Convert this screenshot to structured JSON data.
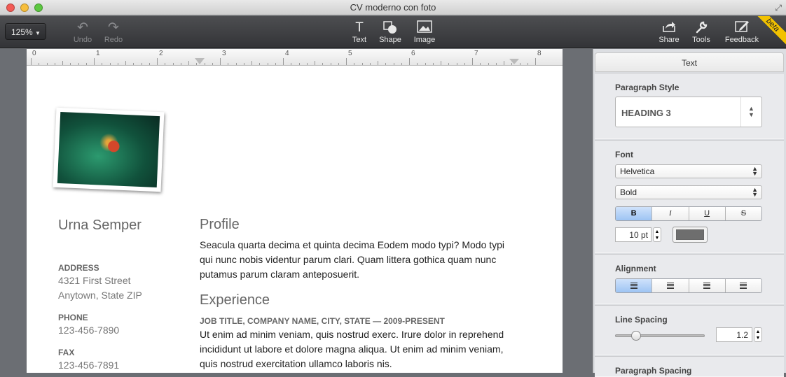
{
  "window": {
    "title": "CV moderno con foto"
  },
  "toolbar": {
    "zoom": "125%",
    "undo": "Undo",
    "redo": "Redo",
    "text": "Text",
    "shape": "Shape",
    "image": "Image",
    "share": "Share",
    "tools": "Tools",
    "feedback": "Feedback",
    "beta": "beta"
  },
  "ruler": {
    "marks": [
      "0",
      "1",
      "2",
      "3",
      "4",
      "5",
      "6",
      "7",
      "8"
    ]
  },
  "document": {
    "name": "Urna Semper",
    "address_label": "ADDRESS",
    "address_line1": "4321 First Street",
    "address_line2": "Anytown, State ZIP",
    "phone_label": "PHONE",
    "phone": "123-456-7890",
    "fax_label": "FAX",
    "fax": "123-456-7891",
    "profile_heading": "Profile",
    "profile_text": "Seacula quarta decima et quinta decima Eodem modo typi? Modo typi qui nunc nobis videntur parum clari. Quam littera gothica quam nunc putamus parum claram anteposuerit.",
    "experience_heading": "Experience",
    "job_title": "JOB TITLE, COMPANY NAME, CITY, STATE — 2009-PRESENT",
    "job_text": "Ut enim ad minim veniam, quis nostrud exerc. Irure dolor in reprehend incididunt ut labore et dolore magna aliqua. Ut enim ad minim veniam, quis nostrud exercitation ullamco laboris nis."
  },
  "inspector": {
    "title": "Text",
    "paragraph_style_label": "Paragraph Style",
    "paragraph_style": "HEADING 3",
    "font_label": "Font",
    "font_family": "Helvetica",
    "font_style": "Bold",
    "bold": "B",
    "italic": "I",
    "underline": "U",
    "strike": "S",
    "font_size": "10 pt",
    "text_color": "#6e6e6e",
    "alignment_label": "Alignment",
    "line_spacing_label": "Line Spacing",
    "line_spacing_value": "1.2",
    "line_spacing_level": 0.19,
    "paragraph_spacing_label": "Paragraph Spacing"
  }
}
